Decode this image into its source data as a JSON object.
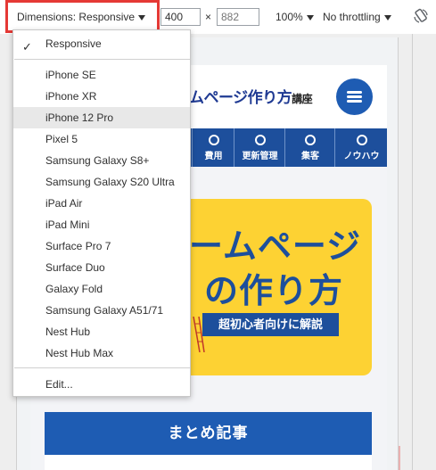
{
  "toolbar": {
    "dimensions_label": "Dimensions: Responsive",
    "width_value": "400",
    "times_symbol": "×",
    "height_placeholder": "882",
    "zoom_label": "100%",
    "throttle_label": "No throttling",
    "rotate_icon": "rotate-icon",
    "highlight_color": "#e53935"
  },
  "dropdown": {
    "items": [
      {
        "label": "Responsive",
        "checked": true
      },
      {
        "label": "iPhone SE"
      },
      {
        "label": "iPhone XR"
      },
      {
        "label": "iPhone 12 Pro",
        "hovered": true
      },
      {
        "label": "Pixel 5"
      },
      {
        "label": "Samsung Galaxy S8+"
      },
      {
        "label": "Samsung Galaxy S20 Ultra"
      },
      {
        "label": "iPad Air"
      },
      {
        "label": "iPad Mini"
      },
      {
        "label": "Surface Pro 7"
      },
      {
        "label": "Surface Duo"
      },
      {
        "label": "Galaxy Fold"
      },
      {
        "label": "Samsung Galaxy A51/71"
      },
      {
        "label": "Nest Hub"
      },
      {
        "label": "Nest Hub Max"
      },
      {
        "label": "Edit..."
      }
    ]
  },
  "site": {
    "title": "ムページ作り方",
    "title_suffix": "講座",
    "nav": [
      {
        "label": "費用",
        "icon": "yen-icon"
      },
      {
        "label": "更新管理",
        "icon": "refresh-icon"
      },
      {
        "label": "集客",
        "icon": "megaphone-icon"
      },
      {
        "label": "ノウハウ",
        "icon": "lightbulb-icon"
      }
    ],
    "hero_line1": "ームページ",
    "hero_line2": "の作り方",
    "hero_badge": "超初心者向けに解説",
    "summary": "まとめ記事",
    "brand_blue": "#1d4f9c",
    "hero_yellow": "#fdd233"
  }
}
